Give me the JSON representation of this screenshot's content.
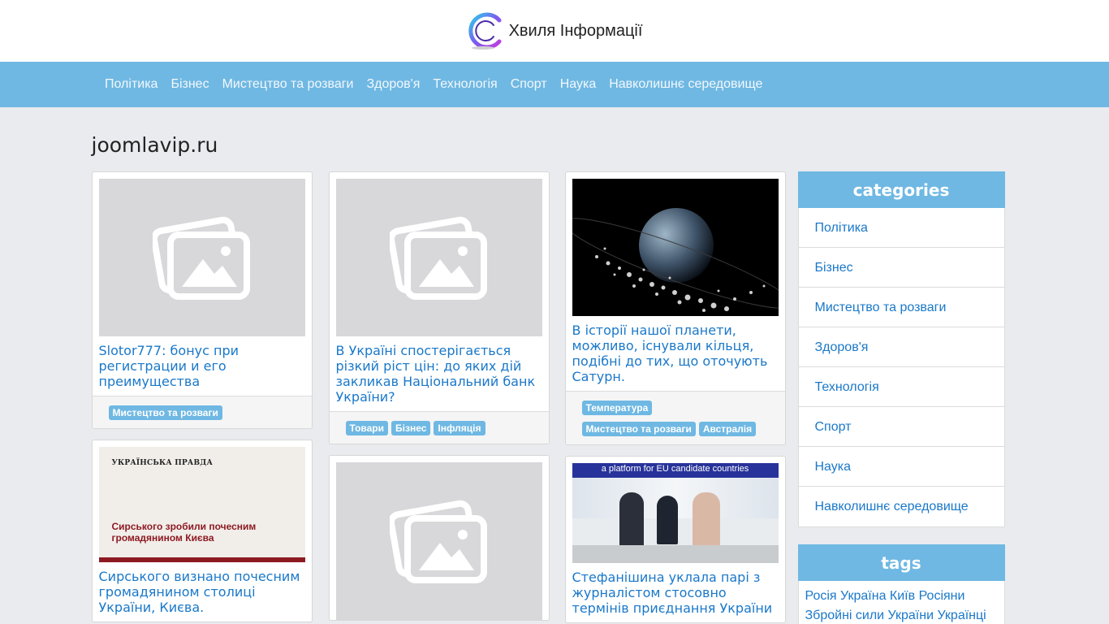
{
  "header": {
    "site_name": "Хвиля Інформації"
  },
  "nav": {
    "items": [
      "Політика",
      "Бізнес",
      "Мистецтво та розваги",
      "Здоров'я",
      "Технологія",
      "Спорт",
      "Наука",
      "Навколишнє середовище"
    ]
  },
  "page": {
    "domain": "joomlavip.ru"
  },
  "articles": {
    "c1": {
      "title": "Slotor777: бонус при регистрации и его преимущества",
      "tags": [
        "Мистецтво та розваги"
      ]
    },
    "c2": {
      "title": "Сирського визнано почесним громадянином столиці України, Києва.",
      "image_heading": "УКРАЇНСЬКА ПРАВДА",
      "image_text": "Сирського зробили почесним громадянином Києва"
    },
    "c3": {
      "title": "В Україні спостерігається різкий ріст цін: до яких дій закликав Національний банк України?",
      "tags": [
        "Товари",
        "Бізнес",
        "Інфляція"
      ]
    },
    "c5": {
      "title": "В історії нашої планети, можливо, існували кільця, подібні до тих, що оточують Сатурн.",
      "tags": [
        "Температура",
        "Мистецтво та розваги",
        "Австралія"
      ]
    },
    "c6": {
      "title": "Стефанішина уклала парі з журналістом стосовно термінів приєднання України",
      "image_banner": "a platform for EU candidate countries"
    }
  },
  "sidebar": {
    "categories_heading": "categories",
    "categories": [
      "Політика",
      "Бізнес",
      "Мистецтво та розваги",
      "Здоров'я",
      "Технологія",
      "Спорт",
      "Наука",
      "Навколишнє середовище"
    ],
    "tags_heading": "tags",
    "tags": [
      "Росія",
      "Україна",
      "Київ",
      "Росіяни",
      "Збройні сили України",
      "Українці"
    ]
  },
  "colors": {
    "accent": "#6fb8e3",
    "link": "#1a78c9",
    "background": "#e9ebef"
  }
}
